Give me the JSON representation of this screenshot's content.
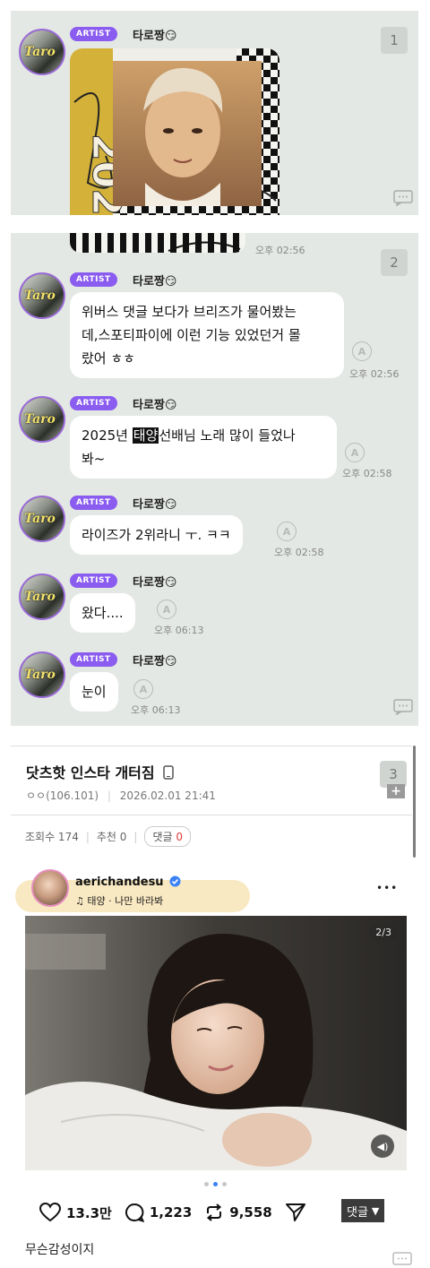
{
  "shot1": {
    "badge_num": "1",
    "artist_badge": "ARTIST",
    "sender": "타로짱😏",
    "avatar_text": "Taro",
    "year_text": "2025"
  },
  "shot2": {
    "badge_num": "2",
    "first_time": "오후 02:56",
    "messages": [
      {
        "sender": "타로짱😏",
        "badge": "ARTIST",
        "avatar_text": "Taro",
        "text_1": "위버스 댓글 보다가 브리즈가 물어봤는",
        "text_2": "데,스포티파이에 이런 기능 있었던거 몰",
        "text_3": "랐어 ㅎㅎ",
        "time": "오후 02:56"
      },
      {
        "sender": "타로짱😏",
        "badge": "ARTIST",
        "avatar_text": "Taro",
        "text_pre": "2025년 ",
        "text_hl": "태양",
        "text_post": "선배님 노래 많이 들었나",
        "text_2": "봐~",
        "time": "오후 02:58"
      },
      {
        "sender": "타로짱😏",
        "badge": "ARTIST",
        "avatar_text": "Taro",
        "text": "라이즈가 2위라니 ㅜ. ㅋㅋ",
        "time": "오후 02:58"
      },
      {
        "sender": "타로짱😏",
        "badge": "ARTIST",
        "avatar_text": "Taro",
        "text": "왔다....",
        "time": "오후 06:13"
      },
      {
        "sender": "타로짱😏",
        "badge": "ARTIST",
        "avatar_text": "Taro",
        "text": "눈이",
        "time": "오후 06:13"
      }
    ]
  },
  "post": {
    "title": "닷츠핫 인스타 개터짐",
    "badge_num": "3",
    "author": "ㅇㅇ(106.101)",
    "date": "2026.02.01 21:41",
    "views": "조회수 174",
    "recommend": "추천 0",
    "comment_label": "댓글",
    "comment_count": "0"
  },
  "instagram": {
    "username": "aerichandesu",
    "song": "태양 · 나만 바라봐",
    "counter": "2/3",
    "likes": "13.3만",
    "comments": "1,223",
    "reposts": "9,558",
    "more": "•••",
    "caption": "무슨감성이지"
  },
  "comment_button": "댓글",
  "colors": {
    "accent": "#8a5cf0",
    "chat_bg": "#e4e8e4",
    "verified": "#3b82f6",
    "comment_count": "#e23c3c"
  }
}
